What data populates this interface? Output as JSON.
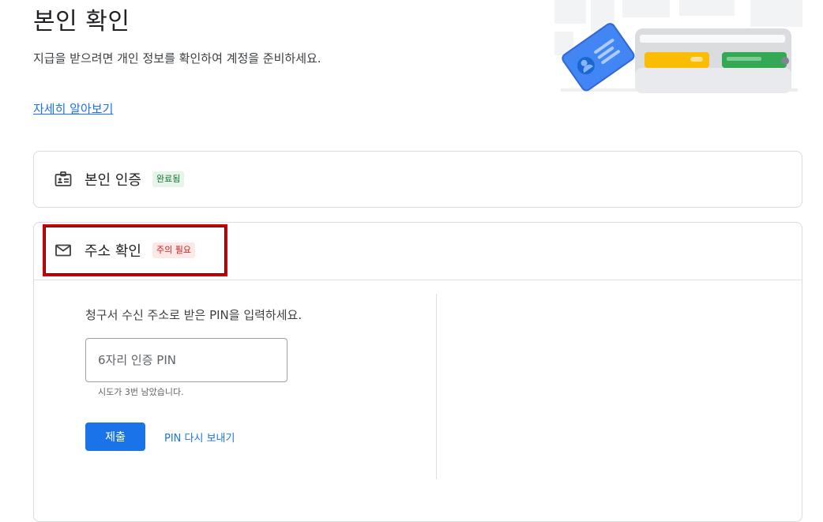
{
  "page": {
    "title": "본인 확인",
    "description": "지급을 받으려면 개인 정보를 확인하여 계정을 준비하세요.",
    "learn_more": "자세히 알아보기"
  },
  "steps": [
    {
      "label": "본인 인증",
      "badge": "완료됨",
      "icon": "id-card-icon"
    },
    {
      "label": "주소 확인",
      "badge": "주의 필요",
      "icon": "mail-icon"
    }
  ],
  "address_verification": {
    "prompt": "청구서 수신 주소로 받은 PIN을 입력하세요.",
    "pin_placeholder": "6자리 인증 PIN",
    "attempts_left": "시도가 3번 남았습니다.",
    "submit_label": "제출",
    "resend_label": "PIN 다시 보내기"
  },
  "colors": {
    "accent": "#1a73e8",
    "success_bg": "#e6f4ea",
    "success_text": "#137333",
    "warning_bg": "#fce8e6",
    "warning_text": "#c5221f",
    "highlight_border": "#d00000"
  }
}
